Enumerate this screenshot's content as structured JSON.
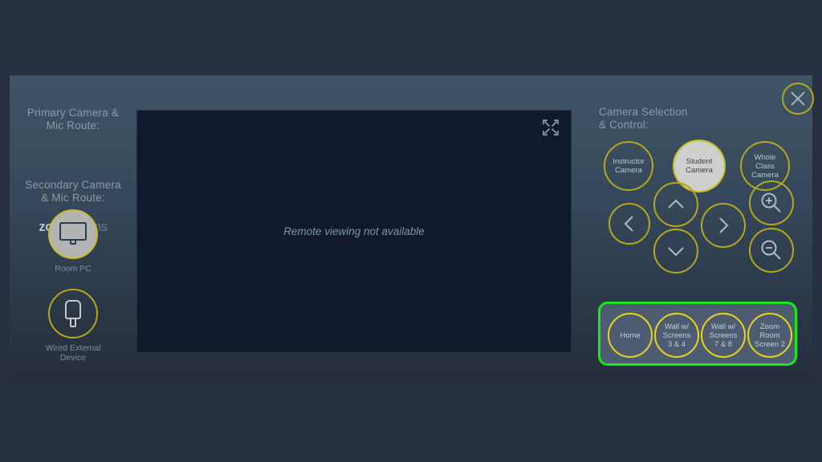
{
  "app": {
    "background_color": "#273040",
    "panel_gradient_top": "#3e5467",
    "panel_gradient_bottom": "#262e3c",
    "accent_yellow": "#b5a81b",
    "highlight_green": "#1ae81a"
  },
  "left_column": {
    "primary_heading": "Primary Camera & Mic Route:",
    "primary_heading_line1": "Primary Camera &",
    "primary_heading_line2": "Mic Route:",
    "logo": {
      "part1": "zoom",
      "part2": "rooms",
      "name": "zoomrooms-logo"
    },
    "secondary_heading_line1": "Secondary Camera",
    "secondary_heading_line2": "& Mic Route:",
    "routes": [
      {
        "label": "Room PC",
        "icon": "monitor-icon",
        "selected": true
      },
      {
        "label_line1": "Wired External",
        "label_line2": "Device",
        "icon": "usb-plug-icon",
        "selected": false
      }
    ]
  },
  "video": {
    "message": "Remote viewing not available",
    "expand_icon": "expand-fullscreen-icon",
    "background_color": "#101a2c"
  },
  "right_column": {
    "camera_heading_line1": "Camera Selection",
    "camera_heading_line2": "& Control:",
    "cameras": [
      {
        "line1": "Instructor",
        "line2": "Camera",
        "line3": "",
        "selected": false
      },
      {
        "line1": "Student",
        "line2": "Camera",
        "line3": "",
        "selected": true
      },
      {
        "line1": "Whole",
        "line2": "Class",
        "line3": "Camera",
        "selected": false
      }
    ],
    "controls": [
      {
        "name": "pan-left-button",
        "icon": "chevron-left-icon"
      },
      {
        "name": "tilt-up-button",
        "icon": "chevron-up-icon"
      },
      {
        "name": "tilt-down-button",
        "icon": "chevron-down-icon"
      },
      {
        "name": "pan-right-button",
        "icon": "chevron-right-icon"
      },
      {
        "name": "zoom-in-button",
        "icon": "magnifier-plus-icon"
      },
      {
        "name": "zoom-out-button",
        "icon": "magnifier-minus-icon"
      }
    ],
    "presets": [
      {
        "line1": "Home",
        "line2": "",
        "line3": ""
      },
      {
        "line1": "Wall w/",
        "line2": "Screens",
        "line3": "3 & 4"
      },
      {
        "line1": "Wall w/",
        "line2": "Screens",
        "line3": "7 & 8"
      },
      {
        "line1": "Zoom",
        "line2": "Room",
        "line3": "Screen 2"
      }
    ],
    "presets_highlighted": true,
    "close_icon": "close-x-icon"
  }
}
